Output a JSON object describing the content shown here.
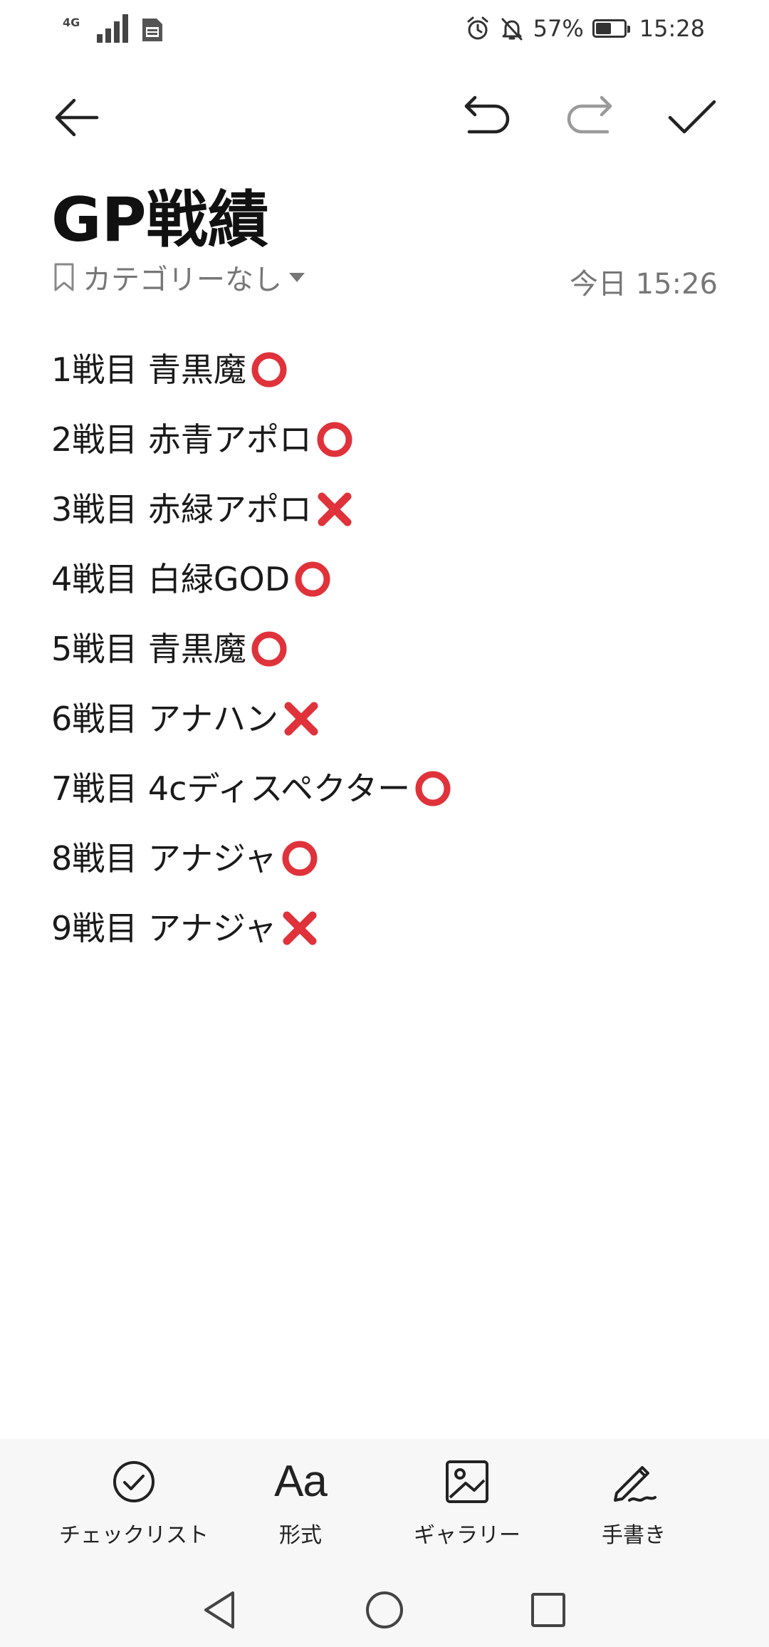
{
  "status_bar": {
    "network": "4G",
    "battery_percent": "57%",
    "battery_level": 0.57,
    "time": "15:28"
  },
  "toolbar": {
    "back_icon": "arrow-left-icon",
    "undo_icon": "undo-icon",
    "redo_icon": "redo-icon",
    "done_icon": "check-icon",
    "redo_enabled": false
  },
  "note": {
    "title": "GP戦績",
    "category": "カテゴリーなし",
    "timestamp": "今日 15:26",
    "lines": [
      {
        "text": "1戦目 青黒魔",
        "result": "circle"
      },
      {
        "text": "2戦目 赤青アポロ",
        "result": "circle"
      },
      {
        "text": "3戦目 赤緑アポロ",
        "result": "cross"
      },
      {
        "text": "4戦目 白緑GOD",
        "result": "circle"
      },
      {
        "text": "5戦目 青黒魔",
        "result": "circle"
      },
      {
        "text": "6戦目 アナハン",
        "result": "cross"
      },
      {
        "text": "7戦目 4cディスペクター",
        "result": "circle"
      },
      {
        "text": "8戦目 アナジャ",
        "result": "circle"
      },
      {
        "text": "9戦目 アナジャ",
        "result": "cross"
      }
    ]
  },
  "actions": {
    "checklist": "チェックリスト",
    "format": "形式",
    "format_icon_text": "Aa",
    "gallery": "ギャラリー",
    "handwriting": "手書き"
  },
  "colors": {
    "accent_red": "#e0323a",
    "text": "#1a1a1a",
    "muted": "#777777",
    "bottom_bar": "#f7f7f7"
  }
}
